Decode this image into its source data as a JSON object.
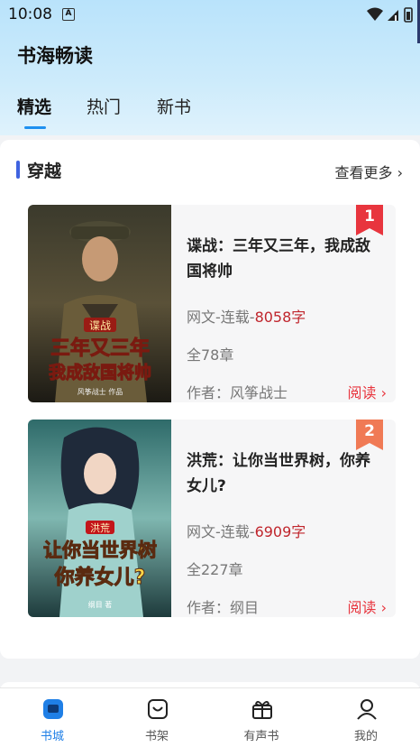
{
  "status_bar": {
    "time": "10:08",
    "a_label": "A"
  },
  "header": {
    "app_title": "书海畅读"
  },
  "tabs": [
    {
      "label": "精选",
      "active": true
    },
    {
      "label": "热门",
      "active": false
    },
    {
      "label": "新书",
      "active": false
    }
  ],
  "section": {
    "title": "穿越",
    "more_label": "查看更多 ›"
  },
  "books": [
    {
      "rank": "1",
      "title": "谍战：三年又三年，我成敌国将帅",
      "meta_prefix": "网文-连载-",
      "word_count": "8058字",
      "chapters": "全78章",
      "author": "作者：风筝战士",
      "read_label": "阅读 ›",
      "cover_tag": "谍战",
      "cover_line1": "三年又三年",
      "cover_line2": "我成敌国将帅",
      "cover_author": "风筝战士 作品"
    },
    {
      "rank": "2",
      "title": "洪荒：让你当世界树，你养女儿?",
      "meta_prefix": "网文-连载-",
      "word_count": "6909字",
      "chapters": "全227章",
      "author": "作者：纲目",
      "read_label": "阅读 ›",
      "cover_tag": "洪荒",
      "cover_line1": "让你当世界树",
      "cover_line2": "你养女儿?",
      "cover_author": "纲目 著"
    }
  ],
  "bottom_nav": [
    {
      "label": "书城",
      "icon": "bookstore-icon",
      "active": true
    },
    {
      "label": "书架",
      "icon": "bookshelf-icon",
      "active": false
    },
    {
      "label": "有声书",
      "icon": "gift-audio-icon",
      "active": false
    },
    {
      "label": "我的",
      "icon": "profile-icon",
      "active": false
    }
  ],
  "colors": {
    "accent": "#1e90f0",
    "section_bar": "#3f63e0",
    "price_red": "#c0262d",
    "read_red": "#e8353e",
    "rank1": "#e8353e",
    "rank2": "#f07a55"
  }
}
